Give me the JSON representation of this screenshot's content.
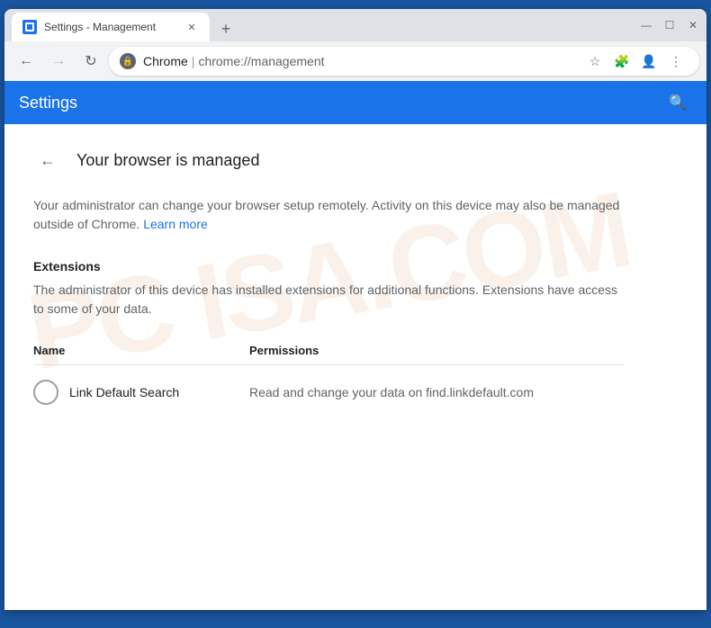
{
  "window": {
    "title": "Settings - Management",
    "new_tab_label": "+"
  },
  "window_controls": {
    "minimize": "—",
    "maximize": "☐",
    "close": "✕"
  },
  "nav": {
    "back_label": "←",
    "forward_label": "→",
    "refresh_label": "↻",
    "domain": "Chrome",
    "separator": "|",
    "path": "chrome://management",
    "star_label": "☆",
    "extensions_label": "🧩",
    "account_label": "👤",
    "menu_label": "⋮"
  },
  "settings": {
    "header_title": "Settings",
    "search_label": "🔍"
  },
  "page": {
    "back_label": "←",
    "title": "Your browser is managed",
    "description": "Your administrator can change your browser setup remotely. Activity on this device may also be managed outside of Chrome.",
    "learn_more_label": "Learn more",
    "extensions_section_title": "Extensions",
    "extensions_description": "The administrator of this device has installed extensions for additional functions. Extensions have access to some of your data.",
    "table_name_header": "Name",
    "table_permissions_header": "Permissions",
    "extensions": [
      {
        "name": "Link Default Search",
        "permissions": "Read and change your data on find.linkdefault.com"
      }
    ]
  },
  "watermark": {
    "text": "PC ISA.COM"
  }
}
